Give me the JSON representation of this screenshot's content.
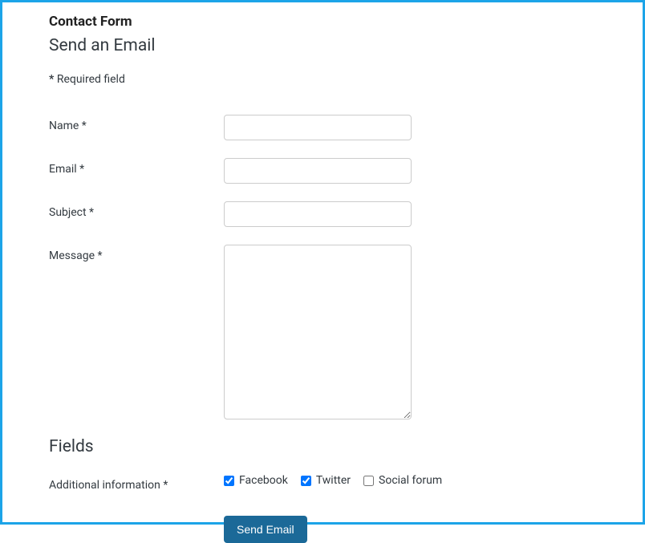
{
  "header": {
    "page_title": "Contact Form",
    "section_heading": "Send an Email",
    "required_note_asterisk": "*",
    "required_note_text": " Required field"
  },
  "form": {
    "name": {
      "label": "Name *",
      "value": ""
    },
    "email": {
      "label": "Email *",
      "value": ""
    },
    "subject": {
      "label": "Subject *",
      "value": ""
    },
    "message": {
      "label": "Message *",
      "value": ""
    }
  },
  "fields": {
    "heading": "Fields",
    "additional_info_label": "Additional information *",
    "checkboxes": {
      "facebook": {
        "label": "Facebook",
        "checked": true
      },
      "twitter": {
        "label": "Twitter",
        "checked": true
      },
      "social_forum": {
        "label": "Social forum",
        "checked": false
      }
    }
  },
  "submit": {
    "label": "Send Email"
  }
}
